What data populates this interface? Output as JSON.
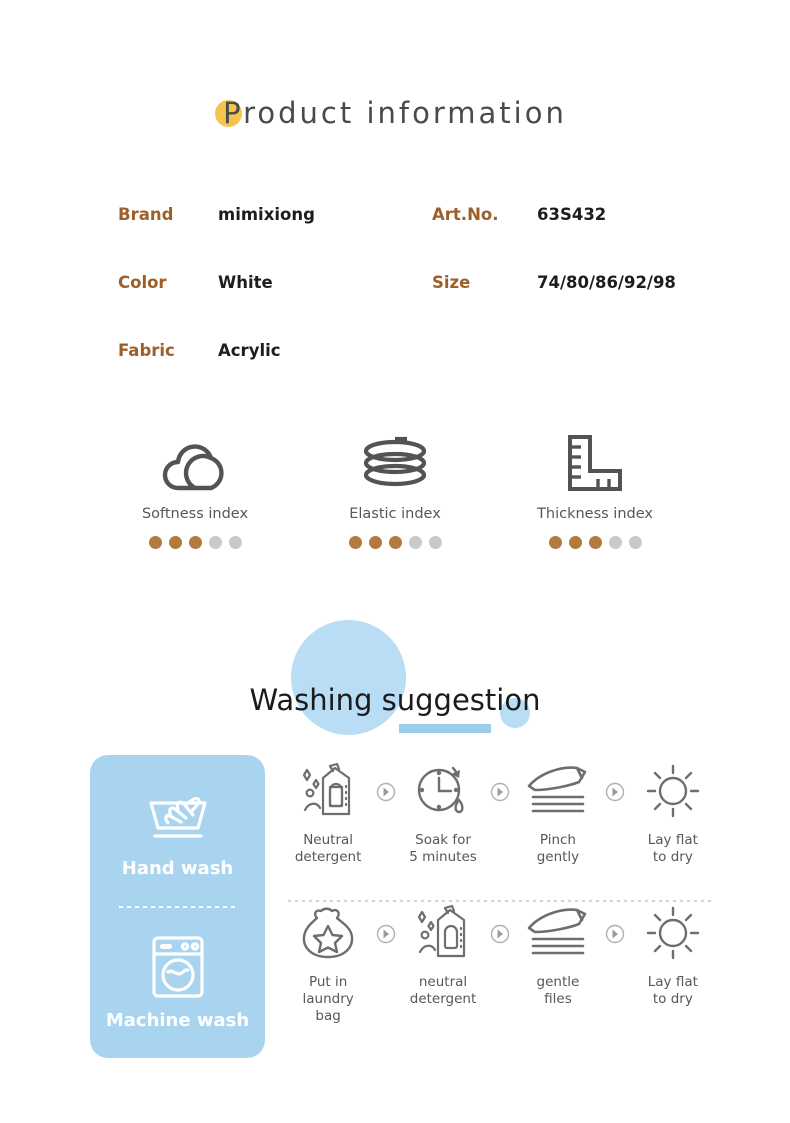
{
  "title": {
    "text": "Product information",
    "accent_dot_color": "#f4c44c"
  },
  "product_info": {
    "left": [
      {
        "label": "Brand",
        "value": "mimixiong"
      },
      {
        "label": "Color",
        "value": "White"
      },
      {
        "label": "Fabric",
        "value": "Acrylic"
      }
    ],
    "right": [
      {
        "label": "Art.No.",
        "value": "63S432"
      },
      {
        "label": "Size",
        "value": "74/80/86/92/98"
      }
    ],
    "label_color": "#9c5f2a",
    "value_color": "#1d1d1d"
  },
  "indices": {
    "filled_color": "#b5783f",
    "empty_color": "#c9c9c9",
    "items": [
      {
        "label": "Softness index",
        "icon": "cloud-icon",
        "rating": 3,
        "max": 5
      },
      {
        "label": "Elastic index",
        "icon": "coil-spring-icon",
        "rating": 3,
        "max": 5
      },
      {
        "label": "Thickness index",
        "icon": "ruler-icon",
        "rating": 3,
        "max": 5
      }
    ]
  },
  "washing": {
    "heading": "Washing suggestion",
    "accent_color": "#b9ddf5",
    "underline_color": "#9ccdec",
    "panel_color": "#a9d4f0",
    "modes": [
      {
        "label": "Hand wash",
        "icon": "hand-wash-icon"
      },
      {
        "label": "Machine wash",
        "icon": "machine-wash-icon"
      }
    ],
    "rows": [
      {
        "steps": [
          {
            "line1": "Neutral",
            "line2": "detergent",
            "icon": "detergent-bottle-icon"
          },
          {
            "line1": "Soak for",
            "line2": "5 minutes",
            "icon": "clock-icon"
          },
          {
            "line1": "Pinch",
            "line2": "gently",
            "icon": "hand-pinch-icon"
          },
          {
            "line1": "Lay flat",
            "line2": "to dry",
            "icon": "sun-icon"
          }
        ]
      },
      {
        "steps": [
          {
            "line1": "Put in",
            "line2": "laundry bag",
            "icon": "laundry-bag-icon"
          },
          {
            "line1": "neutral",
            "line2": "detergent",
            "icon": "detergent-bottle-icon"
          },
          {
            "line1": "gentle",
            "line2": "files",
            "icon": "hand-pinch-icon"
          },
          {
            "line1": "Lay flat",
            "line2": "to dry",
            "icon": "sun-icon"
          }
        ]
      }
    ],
    "arrow_icon": "chevron-right-circle-icon"
  }
}
